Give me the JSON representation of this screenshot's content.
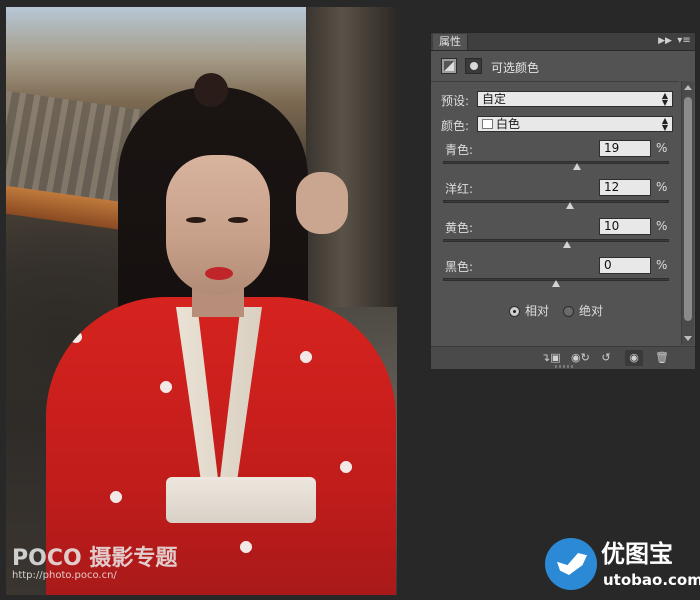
{
  "panel": {
    "tab_label": "属性",
    "title": "可选颜色",
    "preset": {
      "label": "预设:",
      "value": "自定"
    },
    "colors": {
      "label": "颜色:",
      "value": "白色",
      "swatch_color": "#ffffff"
    },
    "sliders": [
      {
        "label": "青色:",
        "value": "19",
        "unit": "%",
        "percent": 19
      },
      {
        "label": "洋红:",
        "value": "12",
        "unit": "%",
        "percent": 12
      },
      {
        "label": "黄色:",
        "value": "10",
        "unit": "%",
        "percent": 10
      },
      {
        "label": "黑色:",
        "value": "0",
        "unit": "%",
        "percent": 0
      }
    ],
    "method": {
      "relative_label": "相对",
      "absolute_label": "绝对",
      "selected": "relative"
    },
    "tab_icons": {
      "collapse": "double-chevron-right-icon",
      "menu": "panel-menu-icon"
    },
    "footer_icons": [
      "clip-to-layer-icon",
      "view-previous-icon",
      "reset-icon",
      "visibility-icon",
      "trash-icon"
    ]
  },
  "watermarks": {
    "left_brand": "POCO 摄影专题",
    "left_url": "http://photo.poco.cn/",
    "right_brand": "优图宝",
    "right_url": "utobao.com"
  },
  "colors": {
    "panel_bg": "#535353",
    "tabbar_bg": "#3f3f3f",
    "canvas_bg": "#282828",
    "robe_red": "#d6231f"
  }
}
